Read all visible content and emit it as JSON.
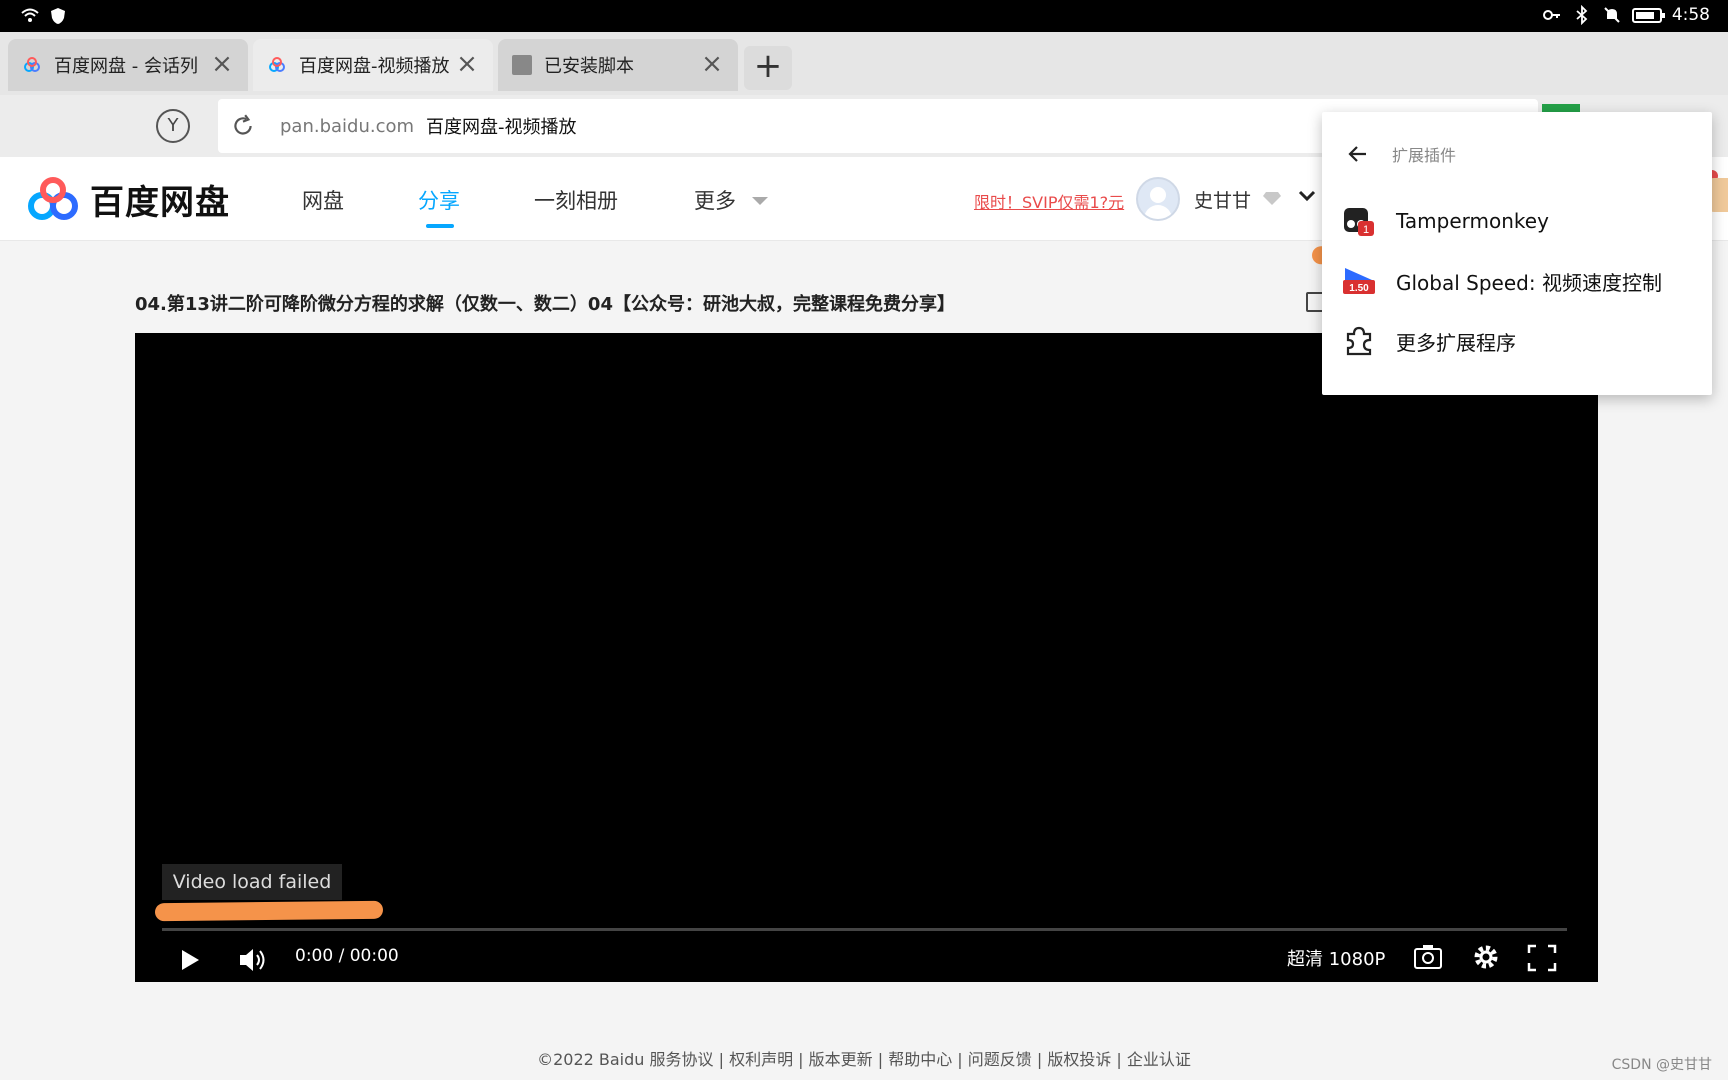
{
  "status_bar": {
    "time": "4:58",
    "left_icons": [
      "wifi-icon",
      "shield-icon"
    ],
    "right_icons": [
      "key-icon",
      "bluetooth-icon",
      "vibrate-icon",
      "mute-icon",
      "battery-icon"
    ]
  },
  "tabs": [
    {
      "title": "百度网盘 - 会话列",
      "favicon": "baidu-pan-favicon",
      "active": false
    },
    {
      "title": "百度网盘-视频播放",
      "favicon": "baidu-pan-favicon",
      "active": true
    },
    {
      "title": "已安装脚本",
      "favicon": "gray-square-favicon",
      "active": false
    }
  ],
  "new_tab_label": "+",
  "address_bar": {
    "yandex_label": "Y",
    "domain": "pan.baidu.com",
    "page_title": "百度网盘-视频播放"
  },
  "site_header": {
    "logo_text": "百度网盘",
    "nav": [
      {
        "label": "网盘",
        "active": false
      },
      {
        "label": "分享",
        "active": true
      },
      {
        "label": "一刻相册",
        "active": false
      },
      {
        "label": "更多",
        "active": false
      }
    ],
    "promo": "限时！SVIP仅需1?元",
    "username": "史甘甘"
  },
  "video": {
    "title": "04.第13讲二阶可降阶微分方程的求解（仅数一、数二）04【公众号：研池大叔，完整课程免费分享】",
    "error_message": "Video load failed",
    "time": "0:00 / 00:00",
    "quality": "超清 1080P",
    "progress": 0
  },
  "extension_popup": {
    "header": "扩展插件",
    "items": [
      {
        "label": "Tampermonkey",
        "icon": "tampermonkey-icon",
        "badge": "1"
      },
      {
        "label": "Global Speed: 视频速度控制",
        "icon": "global-speed-icon",
        "badge": "1.50"
      },
      {
        "label": "更多扩展程序",
        "icon": "puzzle-icon"
      }
    ]
  },
  "footer": {
    "text": "©2022 Baidu  服务协议 | 权利声明 | 版本更新 | 帮助中心 | 问题反馈 | 版权投诉 | 企业认证"
  },
  "watermark": "CSDN @史甘甘",
  "colors": {
    "accent": "#06a7ff",
    "highlight": "#f5934a",
    "promo": "#e94b4b"
  }
}
